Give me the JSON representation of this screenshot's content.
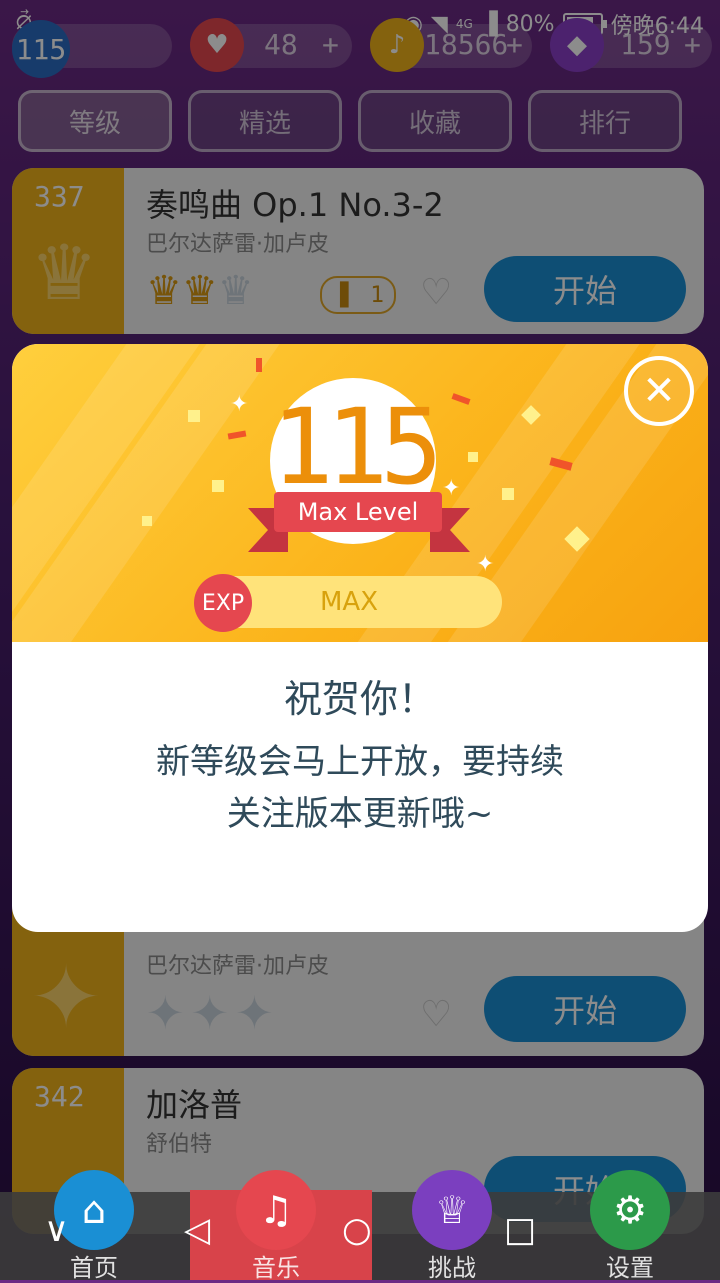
{
  "status_bar": {
    "left_icon": "swirl-icon",
    "battery": "80%",
    "time": "傍晚6:44",
    "network": "4G"
  },
  "currency": {
    "level": "115",
    "lives": "48",
    "notes": "18566",
    "gems": "159",
    "plus": "+"
  },
  "tabs": [
    {
      "label": "等级"
    },
    {
      "label": "精选"
    },
    {
      "label": "收藏"
    },
    {
      "label": "排行"
    }
  ],
  "songs": [
    {
      "rank": "337",
      "title": "奏鸣曲 Op.1 No.3-2",
      "artist": "巴尔达萨雷·加卢皮",
      "plays": "1",
      "start": "开始"
    },
    {
      "rank": "",
      "title": "",
      "artist": "巴尔达萨雷·加卢皮",
      "start": "开始"
    },
    {
      "rank": "342",
      "title": "加洛普",
      "artist": "舒伯特",
      "start": "开始"
    }
  ],
  "modal": {
    "level": "115",
    "ribbon": "Max Level",
    "exp_badge": "EXP",
    "exp_text": "MAX",
    "congrats": "祝贺你！",
    "message_line1": "新等级会马上开放，要持续",
    "message_line2": "关注版本更新哦~"
  },
  "nav": {
    "home": "首页",
    "music": "音乐",
    "challenge": "挑战",
    "settings": "设置"
  },
  "colors": {
    "accent_blue": "#1a8fd4",
    "gold": "#f0b21a",
    "red": "#e5474f"
  }
}
